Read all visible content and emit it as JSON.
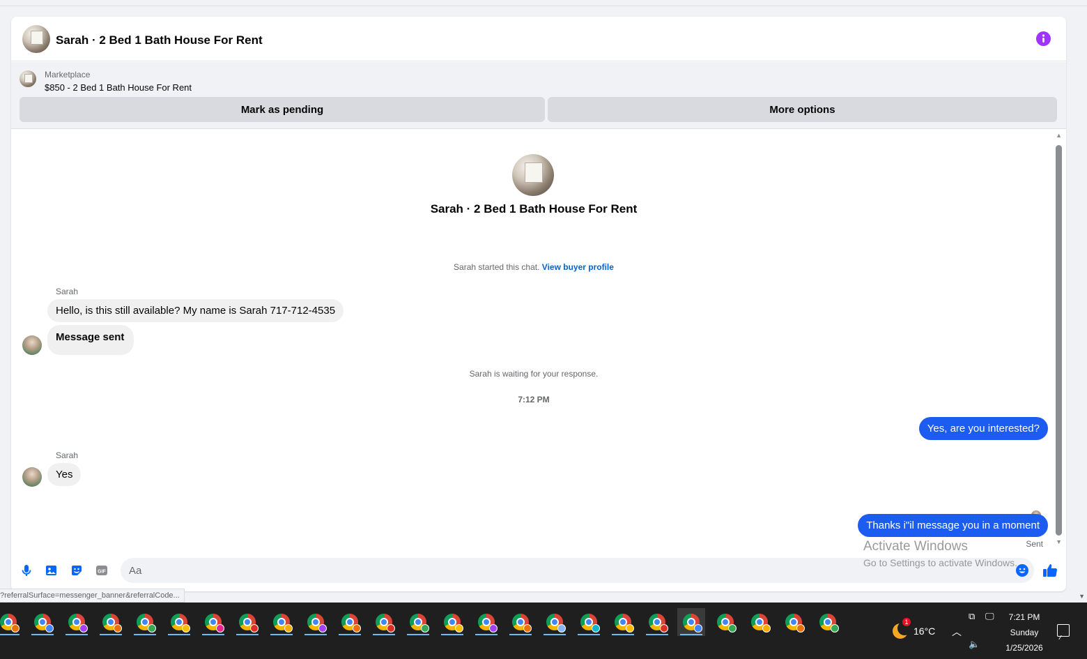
{
  "header": {
    "title": "Sarah · 2 Bed 1 Bath House For Rent",
    "info_icon": "info-icon"
  },
  "banner": {
    "source_label": "Marketplace",
    "listing": "$850 - 2 Bed 1 Bath House For Rent",
    "mark_pending_label": "Mark as pending",
    "more_options_label": "More options"
  },
  "chat": {
    "title": "Sarah · 2 Bed 1 Bath House For Rent",
    "started_text": "Sarah started this chat.",
    "view_profile_link": "View buyer profile",
    "messages": [
      {
        "sender": "Sarah",
        "direction": "in",
        "text": "Hello, is this still available? My name is Sarah 717-712-4535"
      },
      {
        "sender": "Sarah",
        "direction": "in",
        "text": "Message sent"
      },
      {
        "sender": "",
        "direction": "out",
        "text": "Yes, are you interested?"
      },
      {
        "sender": "Sarah",
        "direction": "in",
        "text": "Yes"
      },
      {
        "sender": "",
        "direction": "out",
        "text": "Thanks i\"il message you in a moment"
      }
    ],
    "waiting_text": "Sarah is waiting for your response.",
    "timestamp": "7:12 PM",
    "sent_status": "Sent"
  },
  "composer": {
    "placeholder": "Aa",
    "icons": [
      "microphone-icon",
      "photo-icon",
      "sticker-icon",
      "gif-icon",
      "emoji-icon",
      "thumbs-up-icon"
    ],
    "gif_label": "GIF"
  },
  "watermark": {
    "title": "Activate Windows",
    "subtitle": "Go to Settings to activate Windows."
  },
  "status_bar": {
    "url": "?referralSurface=messenger_banner&referralCode..."
  },
  "taskbar": {
    "app_count": 25,
    "badge_colors": [
      "#e8710a",
      "#4285f4",
      "#a142f4",
      "#e8710a",
      "#34a853",
      "#fbbc04",
      "#e52592",
      "#d93025",
      "#f9ab00",
      "#a142f4",
      "#e8710a",
      "#d93025",
      "#34a853",
      "#fbbc04",
      "#a142f4",
      "#e8710a",
      "#8ab4f8",
      "#12b5cb",
      "#fbbc04",
      "#d93025",
      "#4285f4",
      "#34a853",
      "#f9ab00",
      "#e8710a",
      "#34a853"
    ],
    "weather_temp": "16°C",
    "weather_alert": "1",
    "time": "7:21 PM",
    "day": "Sunday",
    "date": "1/25/2026"
  }
}
